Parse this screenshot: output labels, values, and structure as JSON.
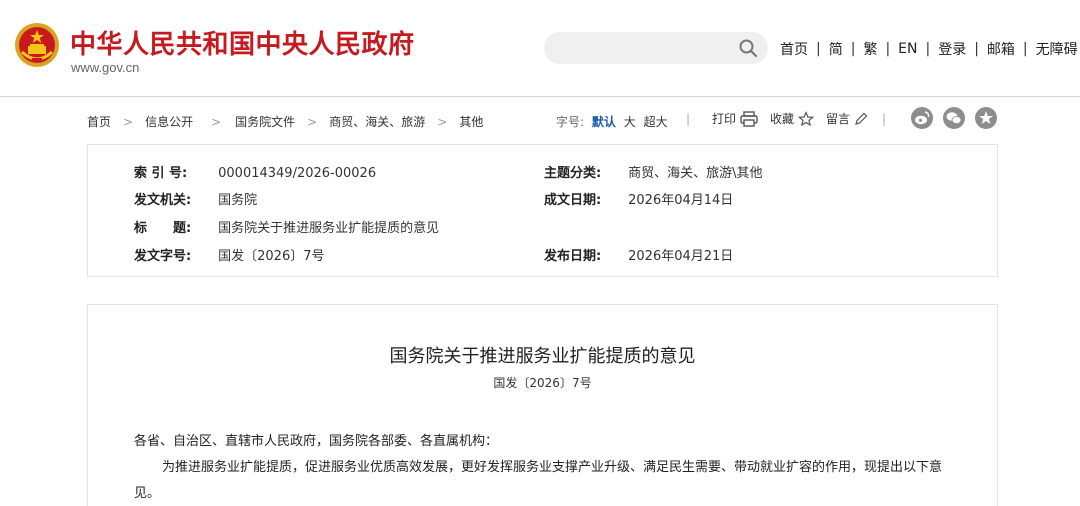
{
  "header": {
    "site_title": "中华人民共和国中央人民政府",
    "site_url": "www.gov.cn",
    "search": {
      "value": "",
      "placeholder": ""
    },
    "nav": [
      "首页",
      "简",
      "繁",
      "EN",
      "登录",
      "邮箱",
      "无障碍"
    ],
    "separator": "|"
  },
  "breadcrumb": {
    "items": [
      "首页",
      "信息公开",
      "国务院文件",
      "商贸、海关、旅游",
      "其他"
    ],
    "arrow": ">"
  },
  "toolbar": {
    "font_size_label": "字号:",
    "font_sizes": [
      "默认",
      "大",
      "超大"
    ],
    "print": "打印",
    "favorite": "收藏",
    "comment": "留言",
    "sep": "|"
  },
  "meta": {
    "index_label": "索 引 号:",
    "index_value": "000014349/2026-00026",
    "category_label": "主题分类:",
    "category_value": "商贸、海关、旅游\\其他",
    "issuer_label": "发文机关:",
    "issuer_value": "国务院",
    "written_date_label": "成文日期:",
    "written_date_value": "2026年04月14日",
    "title_label": "标　　题:",
    "title_value": "国务院关于推进服务业扩能提质的意见",
    "doc_no_label": "发文字号:",
    "doc_no_value": "国发〔2026〕7号",
    "publish_date_label": "发布日期:",
    "publish_date_value": "2026年04月21日"
  },
  "document": {
    "title": "国务院关于推进服务业扩能提质的意见",
    "number": "国发〔2026〕7号",
    "salutation": "各省、自治区、直辖市人民政府，国务院各部委、各直属机构：",
    "paragraph1": "为推进服务业扩能提质，促进服务业优质高效发展，更好发挥服务业支撑产业升级、满足民生需要、带动就业扩容的作用，现提出以下意见。"
  },
  "colors": {
    "brand_red": "#c71a1e",
    "active_font_size": "#1a5ba8",
    "share_icon_gray": "#8d8d8d"
  }
}
